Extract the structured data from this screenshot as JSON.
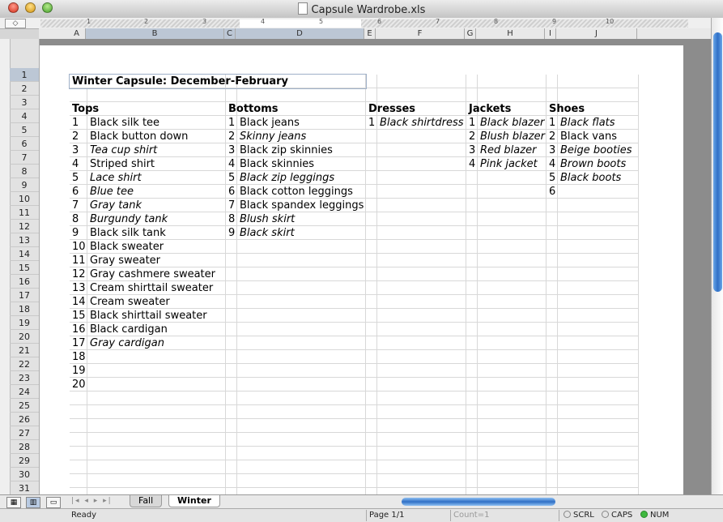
{
  "window": {
    "title": "Capsule Wardrobe.xls"
  },
  "ruler": {
    "numbers": [
      "1",
      "2",
      "3",
      "4",
      "5",
      "6",
      "7",
      "8",
      "9",
      "10"
    ]
  },
  "columns": [
    "A",
    "B",
    "C",
    "D",
    "E",
    "F",
    "G",
    "H",
    "I",
    "J"
  ],
  "rows": [
    "1",
    "2",
    "3",
    "4",
    "5",
    "6",
    "7",
    "8",
    "9",
    "10",
    "11",
    "12",
    "13",
    "14",
    "15",
    "16",
    "17",
    "18",
    "19",
    "20",
    "21",
    "22",
    "23",
    "24",
    "25",
    "26",
    "27",
    "28",
    "29",
    "30",
    "31"
  ],
  "sheet": {
    "title": "Winter Capsule: December-February",
    "headers": {
      "tops": "Tops",
      "bottoms": "Bottoms",
      "dresses": "Dresses",
      "jackets": "Jackets",
      "shoes": "Shoes"
    },
    "tops": [
      {
        "n": "1",
        "item": "Black silk tee",
        "italic": false
      },
      {
        "n": "2",
        "item": "Black button down",
        "italic": false
      },
      {
        "n": "3",
        "item": "Tea cup shirt",
        "italic": true
      },
      {
        "n": "4",
        "item": "Striped shirt",
        "italic": false
      },
      {
        "n": "5",
        "item": "Lace shirt",
        "italic": true
      },
      {
        "n": "6",
        "item": "Blue tee",
        "italic": true
      },
      {
        "n": "7",
        "item": "Gray tank",
        "italic": true
      },
      {
        "n": "8",
        "item": "Burgundy tank",
        "italic": true
      },
      {
        "n": "9",
        "item": "Black silk tank",
        "italic": false
      },
      {
        "n": "10",
        "item": "Black sweater",
        "italic": false
      },
      {
        "n": "11",
        "item": "Gray sweater",
        "italic": false
      },
      {
        "n": "12",
        "item": "Gray cashmere sweater",
        "italic": false
      },
      {
        "n": "13",
        "item": "Cream shirttail sweater",
        "italic": false
      },
      {
        "n": "14",
        "item": "Cream sweater",
        "italic": false
      },
      {
        "n": "15",
        "item": "Black shirttail sweater",
        "italic": false
      },
      {
        "n": "16",
        "item": "Black cardigan",
        "italic": false
      },
      {
        "n": "17",
        "item": "Gray cardigan",
        "italic": true
      },
      {
        "n": "18",
        "item": "",
        "italic": false
      },
      {
        "n": "19",
        "item": "",
        "italic": false
      },
      {
        "n": "20",
        "item": "",
        "italic": false
      }
    ],
    "bottoms": [
      {
        "n": "1",
        "item": "Black jeans",
        "italic": false
      },
      {
        "n": "2",
        "item": "Skinny jeans",
        "italic": true
      },
      {
        "n": "3",
        "item": "Black zip skinnies",
        "italic": false
      },
      {
        "n": "4",
        "item": "Black skinnies",
        "italic": false
      },
      {
        "n": "5",
        "item": "Black zip leggings",
        "italic": true
      },
      {
        "n": "6",
        "item": "Black cotton leggings",
        "italic": false
      },
      {
        "n": "7",
        "item": "Black spandex leggings",
        "italic": false
      },
      {
        "n": "8",
        "item": "Blush skirt",
        "italic": true
      },
      {
        "n": "9",
        "item": "Black skirt",
        "italic": true
      }
    ],
    "dresses": [
      {
        "n": "1",
        "item": "Black shirtdress",
        "italic": true
      }
    ],
    "jackets": [
      {
        "n": "1",
        "item": "Black blazer",
        "italic": true
      },
      {
        "n": "2",
        "item": "Blush blazer",
        "italic": true
      },
      {
        "n": "3",
        "item": "Red blazer",
        "italic": true
      },
      {
        "n": "4",
        "item": "Pink jacket",
        "italic": true
      }
    ],
    "shoes": [
      {
        "n": "1",
        "item": "Black flats",
        "italic": true
      },
      {
        "n": "2",
        "item": "Black vans",
        "italic": false
      },
      {
        "n": "3",
        "item": "Beige booties",
        "italic": true
      },
      {
        "n": "4",
        "item": "Brown boots",
        "italic": true
      },
      {
        "n": "5",
        "item": "Black boots",
        "italic": true
      },
      {
        "n": "6",
        "item": "",
        "italic": false
      }
    ]
  },
  "tabs": {
    "fall": "Fall",
    "winter": "Winter"
  },
  "status": {
    "ready": "Ready",
    "page": "Page 1/1",
    "count": "Count=1",
    "scrl": "SCRL",
    "caps": "CAPS",
    "num": "NUM"
  },
  "colors": {
    "selection": "#bcc7d5",
    "scroll_accent": "#2f6fc6",
    "num_indicator": "#3fb83f"
  }
}
